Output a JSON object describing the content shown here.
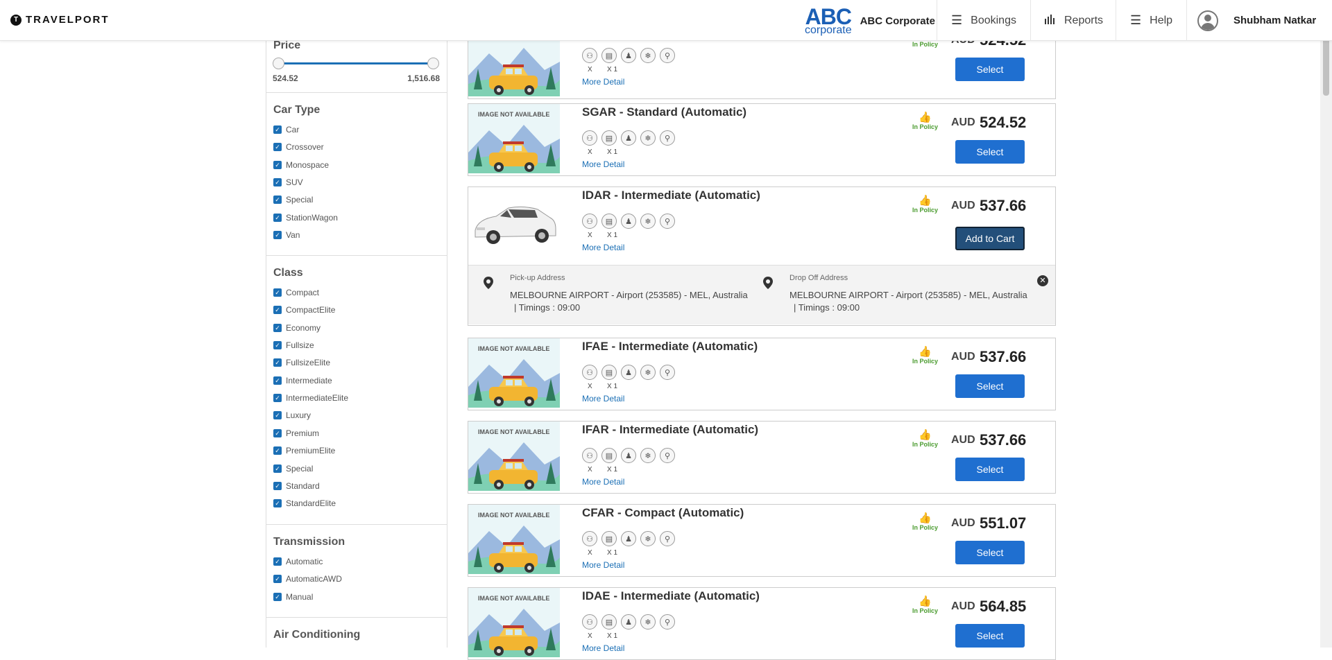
{
  "header": {
    "brand": "TRAVELPORT",
    "brand_mark": "T",
    "corp_logo_main": "ABC",
    "corp_logo_sub": "corporate",
    "corp_name": "ABC Corporate",
    "nav": [
      {
        "label": "Bookings",
        "icon": "menu-icon"
      },
      {
        "label": "Reports",
        "icon": "bar-chart-icon"
      },
      {
        "label": "Help",
        "icon": "menu-icon"
      }
    ],
    "user_name": "Shubham Natkar"
  },
  "filters": {
    "price": {
      "title": "Price",
      "min": "524.52",
      "max": "1,516.68"
    },
    "car_type": {
      "title": "Car Type",
      "options": [
        "Car",
        "Crossover",
        "Monospace",
        "SUV",
        "Special",
        "StationWagon",
        "Van"
      ]
    },
    "class": {
      "title": "Class",
      "options": [
        "Compact",
        "CompactElite",
        "Economy",
        "Fullsize",
        "FullsizeElite",
        "Intermediate",
        "IntermediateElite",
        "Luxury",
        "Premium",
        "PremiumElite",
        "Special",
        "Standard",
        "StandardElite"
      ]
    },
    "transmission": {
      "title": "Transmission",
      "options": [
        "Automatic",
        "AutomaticAWD",
        "Manual"
      ]
    },
    "air_conditioning": {
      "title": "Air Conditioning"
    }
  },
  "labels": {
    "image_not_available": "IMAGE NOT AVAILABLE",
    "more_detail": "More Detail",
    "in_policy": "In Policy",
    "currency": "AUD",
    "select": "Select",
    "add_to_cart": "Add to Cart",
    "passengers": "X",
    "bags": "X 1",
    "pickup_label": "Pick-up Address",
    "dropoff_label": "Drop Off Address"
  },
  "cars": [
    {
      "title": "",
      "price": "524.52",
      "button": "Select",
      "image": "placeholder"
    },
    {
      "title": "SGAR - Standard (Automatic)",
      "price": "524.52",
      "button": "Select",
      "image": "placeholder"
    },
    {
      "title": "IDAR - Intermediate (Automatic)",
      "price": "537.66",
      "button": "Add to Cart",
      "image": "photo"
    },
    {
      "title": "IFAE - Intermediate (Automatic)",
      "price": "537.66",
      "button": "Select",
      "image": "placeholder"
    },
    {
      "title": "IFAR - Intermediate (Automatic)",
      "price": "537.66",
      "button": "Select",
      "image": "placeholder"
    },
    {
      "title": "CFAR - Compact (Automatic)",
      "price": "551.07",
      "button": "Select",
      "image": "placeholder"
    },
    {
      "title": "IDAE - Intermediate (Automatic)",
      "price": "564.85",
      "button": "Select",
      "image": "placeholder"
    }
  ],
  "expanded": {
    "pickup_address": "MELBOURNE AIRPORT - Airport (253585) - MEL, Australia",
    "pickup_timing": "| Timings : 09:00",
    "dropoff_address": "MELBOURNE AIRPORT - Airport (253585) - MEL, Australia",
    "dropoff_timing": "| Timings : 09:00"
  }
}
